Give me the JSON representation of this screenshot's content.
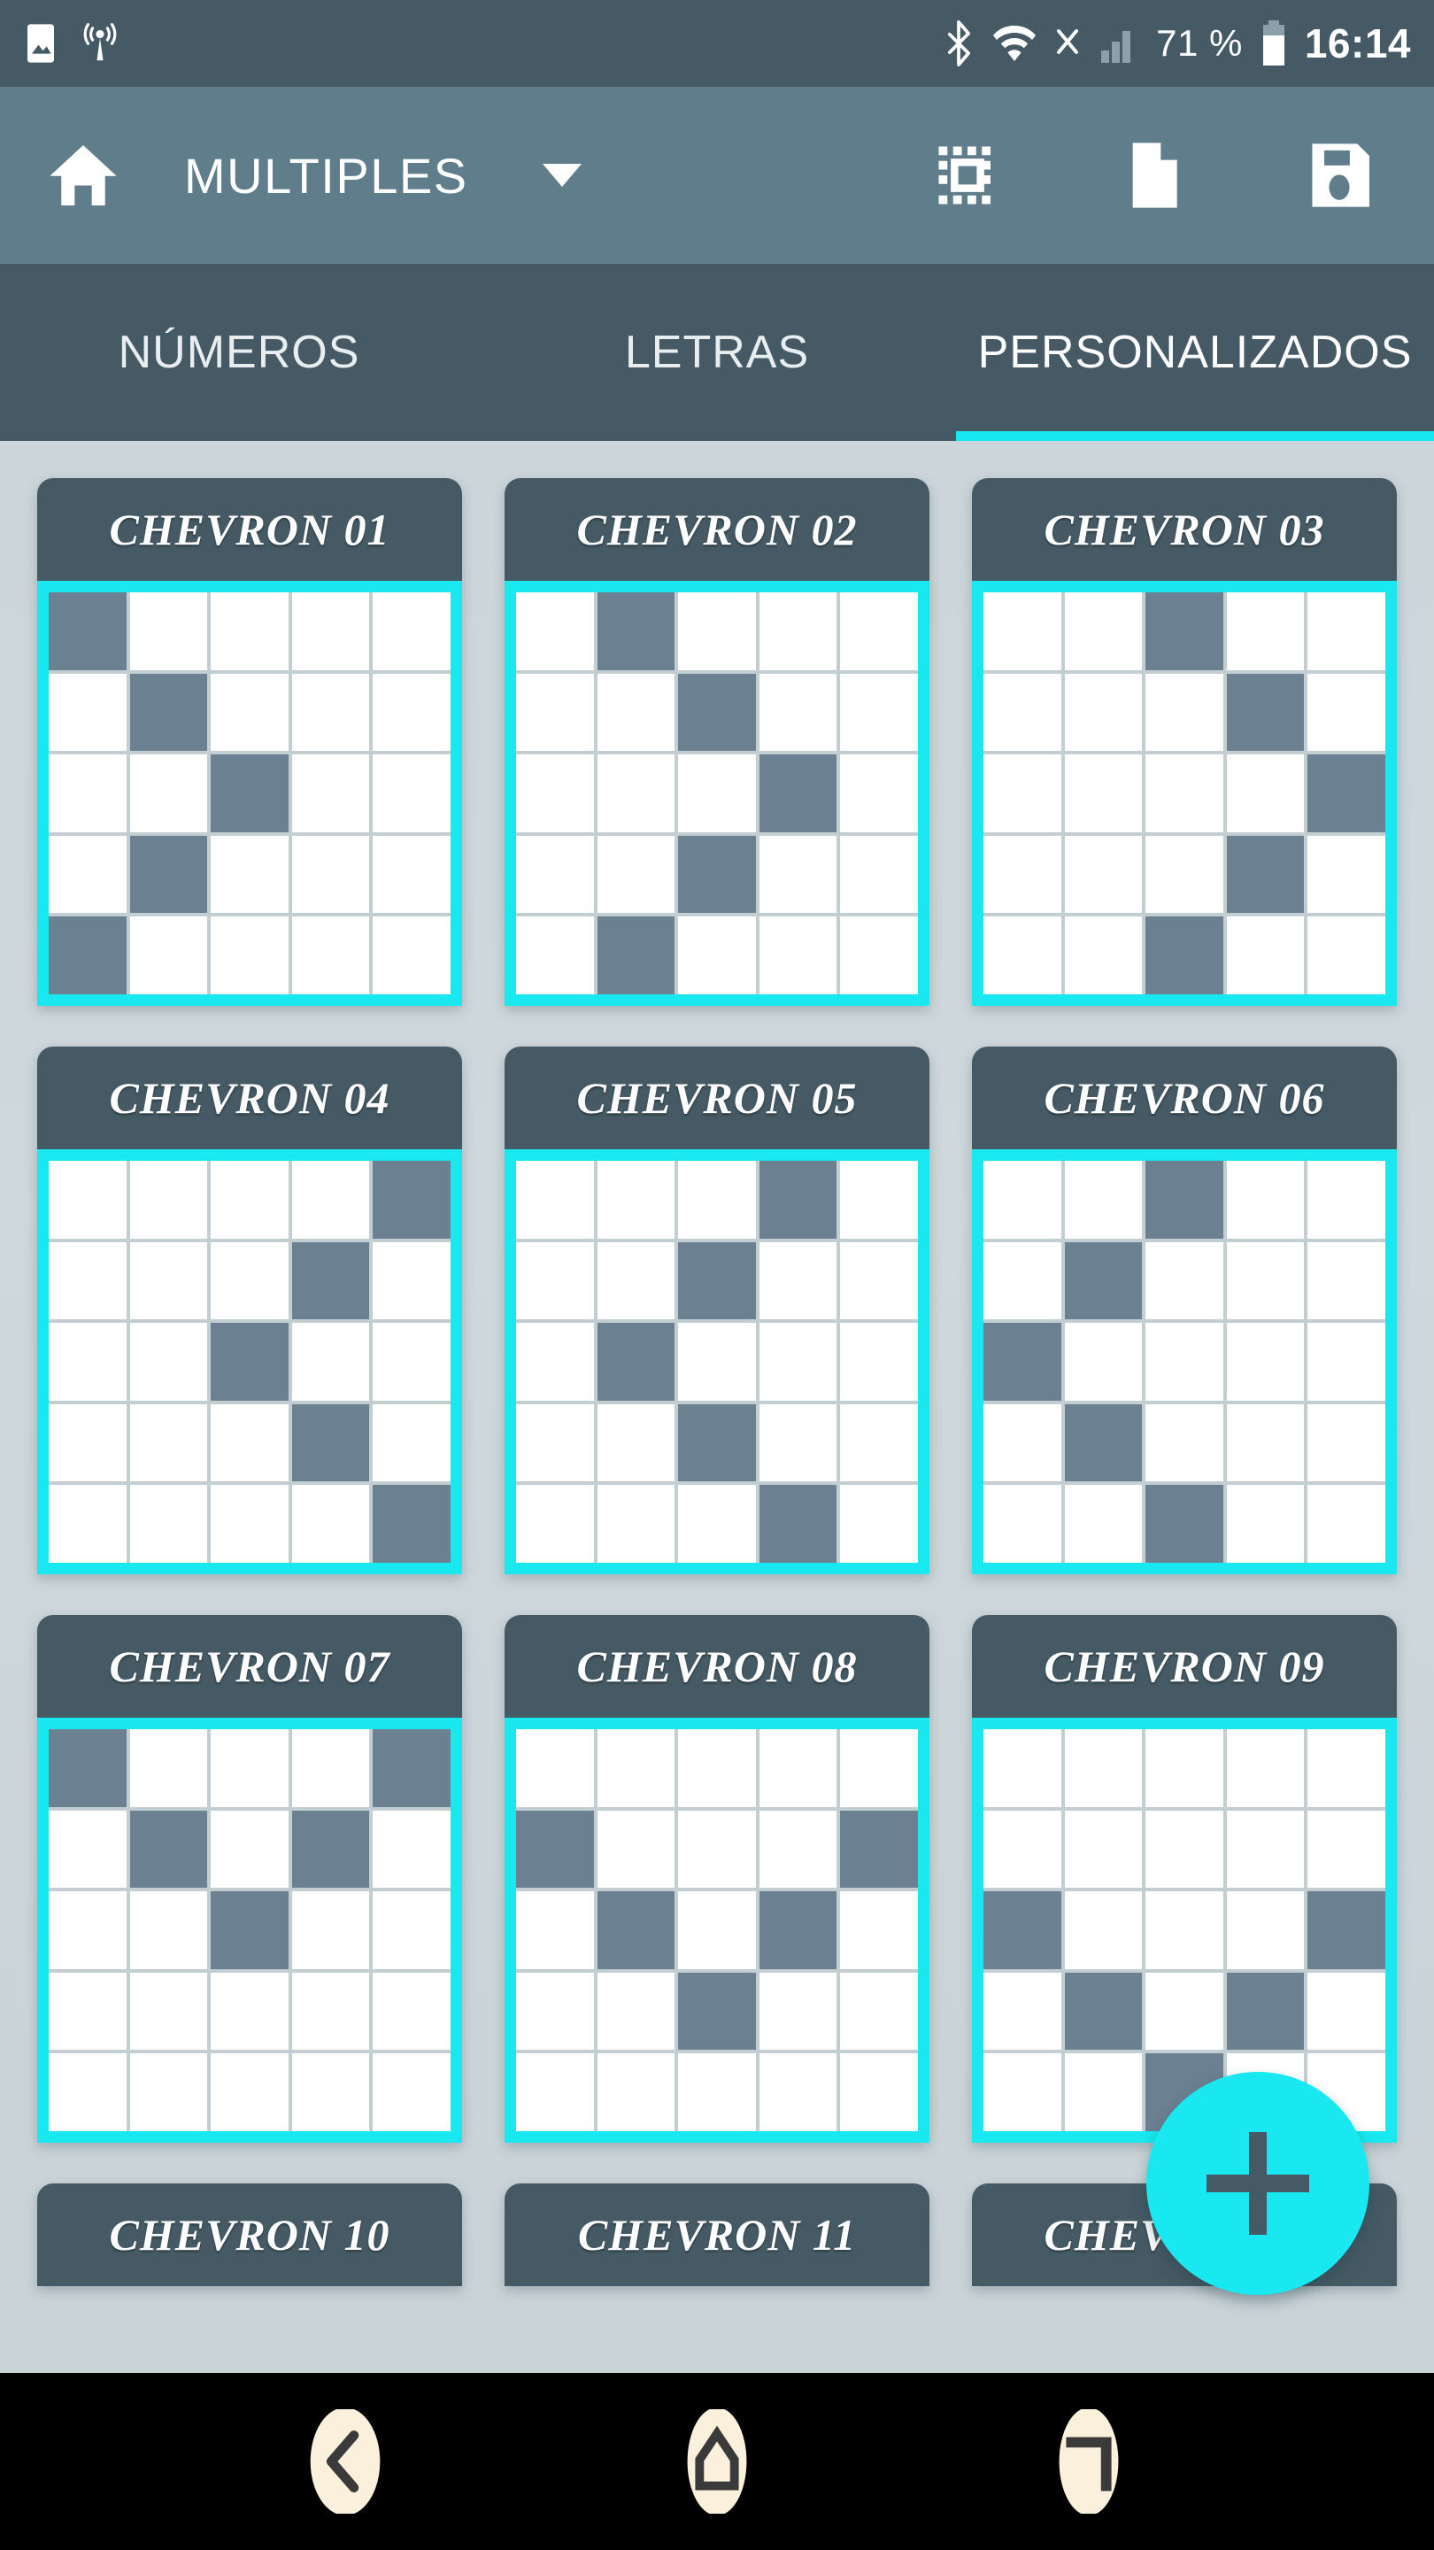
{
  "status_bar": {
    "icons": [
      "image-icon",
      "cast-signal-icon",
      "bluetooth-icon",
      "wifi-icon",
      "no-sim-icon",
      "signal-bars-icon",
      "battery-icon"
    ],
    "battery_percent": "71 %",
    "clock": "16:14"
  },
  "toolbar": {
    "home_label": "home-icon",
    "title": "MULTIPLES",
    "dropdown_icon": "chevron-down-icon",
    "actions": [
      {
        "name": "select-all-icon"
      },
      {
        "name": "new-file-icon"
      },
      {
        "name": "save-icon"
      }
    ]
  },
  "tabs": {
    "items": [
      {
        "label": "NÚMEROS",
        "active": false
      },
      {
        "label": "LETRAS",
        "active": false
      },
      {
        "label": "PERSONALIZADOS",
        "active": true
      }
    ],
    "indicator_color": "#19e8f0"
  },
  "colors": {
    "status_bar_bg": "#455a64",
    "toolbar_bg": "#607d8b",
    "tabbar_bg": "#455a64",
    "content_bg": "#ccd6da",
    "card_header_bg": "#455a64",
    "grid_frame": "#19e8f0",
    "cell_on": "#6b8091",
    "cell_off": "#ffffff",
    "accent": "#19e8f0",
    "navbar_bg": "#000000",
    "nav_icon": "#faf0dc"
  },
  "fab": {
    "label": "+",
    "name": "add-pattern-fab"
  },
  "navbar": {
    "buttons": [
      {
        "name": "back-button",
        "icon": "chevron-left-icon"
      },
      {
        "name": "home-button",
        "icon": "home-outline-icon"
      },
      {
        "name": "recents-button",
        "icon": "recents-icon"
      }
    ]
  },
  "cards": [
    {
      "title": "CHEVRON 01",
      "rows": 5,
      "cols": 5,
      "cells": [
        [
          1,
          0,
          0,
          0,
          0
        ],
        [
          0,
          1,
          0,
          0,
          0
        ],
        [
          0,
          0,
          1,
          0,
          0
        ],
        [
          0,
          1,
          0,
          0,
          0
        ],
        [
          1,
          0,
          0,
          0,
          0
        ]
      ]
    },
    {
      "title": "CHEVRON 02",
      "rows": 5,
      "cols": 5,
      "cells": [
        [
          0,
          1,
          0,
          0,
          0
        ],
        [
          0,
          0,
          1,
          0,
          0
        ],
        [
          0,
          0,
          0,
          1,
          0
        ],
        [
          0,
          0,
          1,
          0,
          0
        ],
        [
          0,
          1,
          0,
          0,
          0
        ]
      ]
    },
    {
      "title": "CHEVRON 03",
      "rows": 5,
      "cols": 5,
      "cells": [
        [
          0,
          0,
          1,
          0,
          0
        ],
        [
          0,
          0,
          0,
          1,
          0
        ],
        [
          0,
          0,
          0,
          0,
          1
        ],
        [
          0,
          0,
          0,
          1,
          0
        ],
        [
          0,
          0,
          1,
          0,
          0
        ]
      ]
    },
    {
      "title": "CHEVRON 04",
      "rows": 5,
      "cols": 5,
      "cells": [
        [
          0,
          0,
          0,
          0,
          1
        ],
        [
          0,
          0,
          0,
          1,
          0
        ],
        [
          0,
          0,
          1,
          0,
          0
        ],
        [
          0,
          0,
          0,
          1,
          0
        ],
        [
          0,
          0,
          0,
          0,
          1
        ]
      ]
    },
    {
      "title": "CHEVRON 05",
      "rows": 5,
      "cols": 5,
      "cells": [
        [
          0,
          0,
          0,
          1,
          0
        ],
        [
          0,
          0,
          1,
          0,
          0
        ],
        [
          0,
          1,
          0,
          0,
          0
        ],
        [
          0,
          0,
          1,
          0,
          0
        ],
        [
          0,
          0,
          0,
          1,
          0
        ]
      ]
    },
    {
      "title": "CHEVRON 06",
      "rows": 5,
      "cols": 5,
      "cells": [
        [
          0,
          0,
          1,
          0,
          0
        ],
        [
          0,
          1,
          0,
          0,
          0
        ],
        [
          1,
          0,
          0,
          0,
          0
        ],
        [
          0,
          1,
          0,
          0,
          0
        ],
        [
          0,
          0,
          1,
          0,
          0
        ]
      ]
    },
    {
      "title": "CHEVRON 07",
      "rows": 5,
      "cols": 5,
      "cells": [
        [
          1,
          0,
          0,
          0,
          1
        ],
        [
          0,
          1,
          0,
          1,
          0
        ],
        [
          0,
          0,
          1,
          0,
          0
        ],
        [
          0,
          0,
          0,
          0,
          0
        ],
        [
          0,
          0,
          0,
          0,
          0
        ]
      ]
    },
    {
      "title": "CHEVRON 08",
      "rows": 5,
      "cols": 5,
      "cells": [
        [
          0,
          0,
          0,
          0,
          0
        ],
        [
          1,
          0,
          0,
          0,
          1
        ],
        [
          0,
          1,
          0,
          1,
          0
        ],
        [
          0,
          0,
          1,
          0,
          0
        ],
        [
          0,
          0,
          0,
          0,
          0
        ]
      ]
    },
    {
      "title": "CHEVRON 09",
      "rows": 5,
      "cols": 5,
      "cells": [
        [
          0,
          0,
          0,
          0,
          0
        ],
        [
          0,
          0,
          0,
          0,
          0
        ],
        [
          1,
          0,
          0,
          0,
          1
        ],
        [
          0,
          1,
          0,
          1,
          0
        ],
        [
          0,
          0,
          1,
          0,
          0
        ]
      ]
    },
    {
      "title": "CHEVRON 10",
      "rows": 5,
      "cols": 5,
      "cells": []
    },
    {
      "title": "CHEVRON 11",
      "rows": 5,
      "cols": 5,
      "cells": []
    },
    {
      "title": "CHEVRON 12",
      "rows": 5,
      "cols": 5,
      "cells": []
    }
  ]
}
